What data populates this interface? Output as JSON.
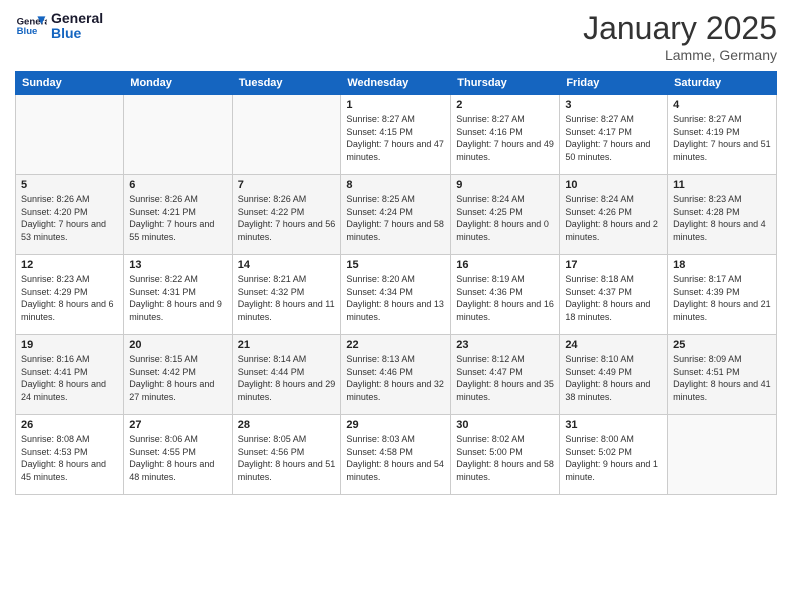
{
  "header": {
    "logo_line1": "General",
    "logo_line2": "Blue",
    "month": "January 2025",
    "location": "Lamme, Germany"
  },
  "weekdays": [
    "Sunday",
    "Monday",
    "Tuesday",
    "Wednesday",
    "Thursday",
    "Friday",
    "Saturday"
  ],
  "weeks": [
    [
      {
        "day": "",
        "info": ""
      },
      {
        "day": "",
        "info": ""
      },
      {
        "day": "",
        "info": ""
      },
      {
        "day": "1",
        "info": "Sunrise: 8:27 AM\nSunset: 4:15 PM\nDaylight: 7 hours\nand 47 minutes."
      },
      {
        "day": "2",
        "info": "Sunrise: 8:27 AM\nSunset: 4:16 PM\nDaylight: 7 hours\nand 49 minutes."
      },
      {
        "day": "3",
        "info": "Sunrise: 8:27 AM\nSunset: 4:17 PM\nDaylight: 7 hours\nand 50 minutes."
      },
      {
        "day": "4",
        "info": "Sunrise: 8:27 AM\nSunset: 4:19 PM\nDaylight: 7 hours\nand 51 minutes."
      }
    ],
    [
      {
        "day": "5",
        "info": "Sunrise: 8:26 AM\nSunset: 4:20 PM\nDaylight: 7 hours\nand 53 minutes."
      },
      {
        "day": "6",
        "info": "Sunrise: 8:26 AM\nSunset: 4:21 PM\nDaylight: 7 hours\nand 55 minutes."
      },
      {
        "day": "7",
        "info": "Sunrise: 8:26 AM\nSunset: 4:22 PM\nDaylight: 7 hours\nand 56 minutes."
      },
      {
        "day": "8",
        "info": "Sunrise: 8:25 AM\nSunset: 4:24 PM\nDaylight: 7 hours\nand 58 minutes."
      },
      {
        "day": "9",
        "info": "Sunrise: 8:24 AM\nSunset: 4:25 PM\nDaylight: 8 hours\nand 0 minutes."
      },
      {
        "day": "10",
        "info": "Sunrise: 8:24 AM\nSunset: 4:26 PM\nDaylight: 8 hours\nand 2 minutes."
      },
      {
        "day": "11",
        "info": "Sunrise: 8:23 AM\nSunset: 4:28 PM\nDaylight: 8 hours\nand 4 minutes."
      }
    ],
    [
      {
        "day": "12",
        "info": "Sunrise: 8:23 AM\nSunset: 4:29 PM\nDaylight: 8 hours\nand 6 minutes."
      },
      {
        "day": "13",
        "info": "Sunrise: 8:22 AM\nSunset: 4:31 PM\nDaylight: 8 hours\nand 9 minutes."
      },
      {
        "day": "14",
        "info": "Sunrise: 8:21 AM\nSunset: 4:32 PM\nDaylight: 8 hours\nand 11 minutes."
      },
      {
        "day": "15",
        "info": "Sunrise: 8:20 AM\nSunset: 4:34 PM\nDaylight: 8 hours\nand 13 minutes."
      },
      {
        "day": "16",
        "info": "Sunrise: 8:19 AM\nSunset: 4:36 PM\nDaylight: 8 hours\nand 16 minutes."
      },
      {
        "day": "17",
        "info": "Sunrise: 8:18 AM\nSunset: 4:37 PM\nDaylight: 8 hours\nand 18 minutes."
      },
      {
        "day": "18",
        "info": "Sunrise: 8:17 AM\nSunset: 4:39 PM\nDaylight: 8 hours\nand 21 minutes."
      }
    ],
    [
      {
        "day": "19",
        "info": "Sunrise: 8:16 AM\nSunset: 4:41 PM\nDaylight: 8 hours\nand 24 minutes."
      },
      {
        "day": "20",
        "info": "Sunrise: 8:15 AM\nSunset: 4:42 PM\nDaylight: 8 hours\nand 27 minutes."
      },
      {
        "day": "21",
        "info": "Sunrise: 8:14 AM\nSunset: 4:44 PM\nDaylight: 8 hours\nand 29 minutes."
      },
      {
        "day": "22",
        "info": "Sunrise: 8:13 AM\nSunset: 4:46 PM\nDaylight: 8 hours\nand 32 minutes."
      },
      {
        "day": "23",
        "info": "Sunrise: 8:12 AM\nSunset: 4:47 PM\nDaylight: 8 hours\nand 35 minutes."
      },
      {
        "day": "24",
        "info": "Sunrise: 8:10 AM\nSunset: 4:49 PM\nDaylight: 8 hours\nand 38 minutes."
      },
      {
        "day": "25",
        "info": "Sunrise: 8:09 AM\nSunset: 4:51 PM\nDaylight: 8 hours\nand 41 minutes."
      }
    ],
    [
      {
        "day": "26",
        "info": "Sunrise: 8:08 AM\nSunset: 4:53 PM\nDaylight: 8 hours\nand 45 minutes."
      },
      {
        "day": "27",
        "info": "Sunrise: 8:06 AM\nSunset: 4:55 PM\nDaylight: 8 hours\nand 48 minutes."
      },
      {
        "day": "28",
        "info": "Sunrise: 8:05 AM\nSunset: 4:56 PM\nDaylight: 8 hours\nand 51 minutes."
      },
      {
        "day": "29",
        "info": "Sunrise: 8:03 AM\nSunset: 4:58 PM\nDaylight: 8 hours\nand 54 minutes."
      },
      {
        "day": "30",
        "info": "Sunrise: 8:02 AM\nSunset: 5:00 PM\nDaylight: 8 hours\nand 58 minutes."
      },
      {
        "day": "31",
        "info": "Sunrise: 8:00 AM\nSunset: 5:02 PM\nDaylight: 9 hours\nand 1 minute."
      },
      {
        "day": "",
        "info": ""
      }
    ]
  ]
}
